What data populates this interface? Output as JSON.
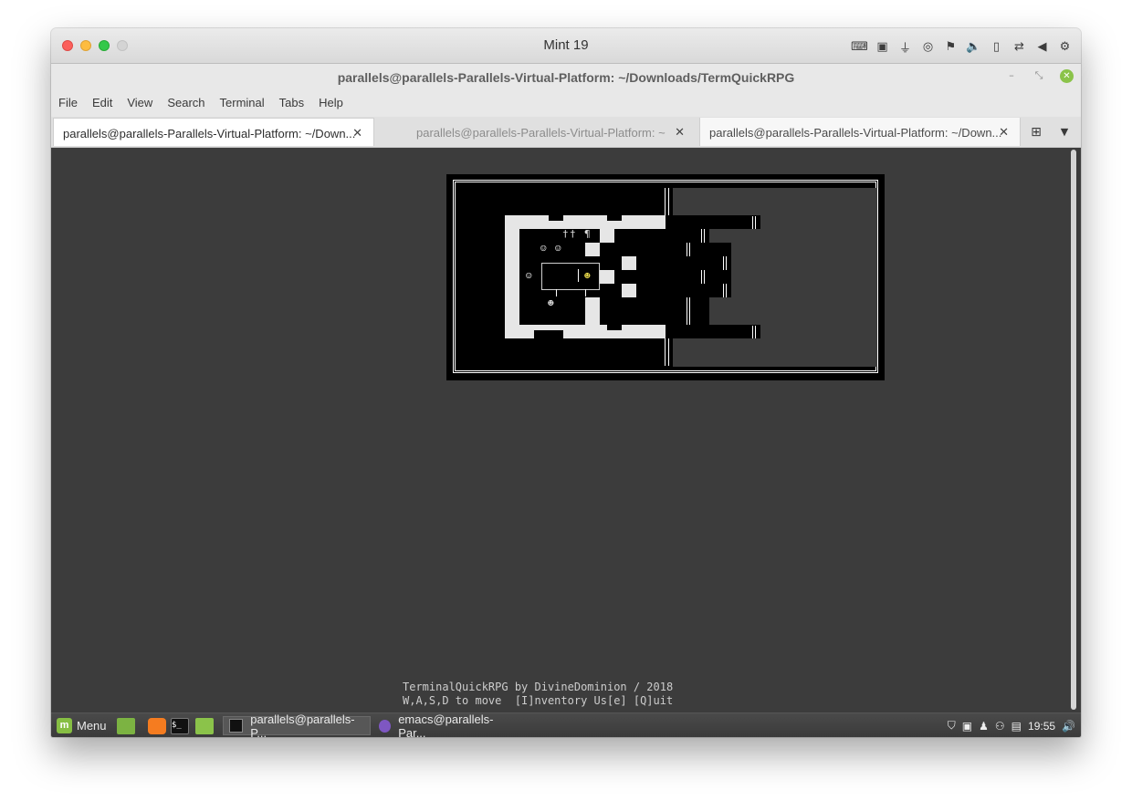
{
  "vm": {
    "title": "Mint 19"
  },
  "terminal": {
    "window_title": "parallels@parallels-Parallels-Virtual-Platform: ~/Downloads/TermQuickRPG",
    "menu": [
      "File",
      "Edit",
      "View",
      "Search",
      "Terminal",
      "Tabs",
      "Help"
    ],
    "tabs": [
      {
        "label": "parallels@parallels-Parallels-Virtual-Platform: ~/Down...",
        "active": true
      },
      {
        "label": "parallels@parallels-Parallels-Virtual-Platform: ~",
        "active": false
      },
      {
        "label": "parallels@parallels-Parallels-Virtual-Platform: ~/Down...",
        "active": false
      }
    ],
    "footer_line1": "TerminalQuickRPG by DivineDominion / 2018",
    "footer_line2": "W,A,S,D to move  [I]nventory Us[e] [Q]uit"
  },
  "map_glyphs": {
    "npc": "☺",
    "player": "☻",
    "cross": "†",
    "pilcrow": "¶"
  },
  "panel": {
    "menu_label": "Menu",
    "tasks": [
      "parallels@parallels-P...",
      "emacs@parallels-Par..."
    ],
    "clock": "19:55"
  },
  "colors": {
    "terminal_bg": "#3c3c3c",
    "player": "#e7d84a",
    "mint_green": "#86be43"
  }
}
